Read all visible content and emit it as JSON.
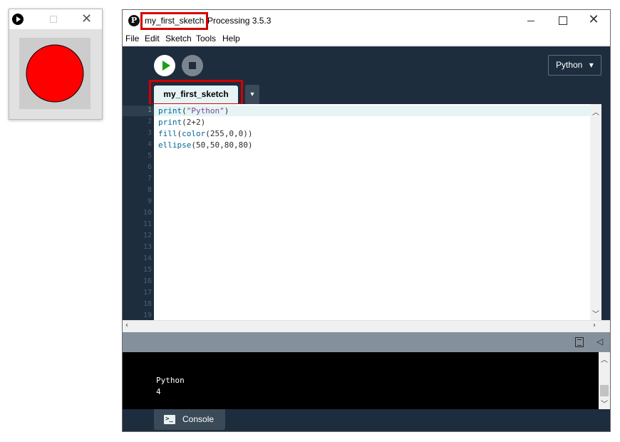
{
  "sketch_window": {
    "circle_color": "#ff0000",
    "background_color": "#cccccc"
  },
  "main_window": {
    "title_sketch": "my_first_sketch",
    "title_app": "Processing 3.5.3"
  },
  "menu": {
    "items": [
      "File",
      "Edit",
      "Sketch",
      "Tools",
      "Help"
    ]
  },
  "toolbar": {
    "run_icon": "play-icon",
    "stop_icon": "stop-icon",
    "mode": "Python",
    "mode_caret": "▾"
  },
  "tabs": {
    "active": "my_first_sketch",
    "menu_caret": "▾"
  },
  "editor": {
    "line_numbers": [
      "1",
      "2",
      "3",
      "4",
      "5",
      "6",
      "7",
      "8",
      "9",
      "10",
      "11",
      "12",
      "13",
      "14",
      "15",
      "16",
      "17",
      "18",
      "19"
    ],
    "code": [
      {
        "fn": "print",
        "args_before": "(",
        "str": "\"Python\"",
        "args_after": ")"
      },
      {
        "fn": "print",
        "args_before": "(2+2)",
        "str": "",
        "args_after": ""
      },
      {
        "fn": "fill",
        "args_before": "(",
        "fn2": "color",
        "args_mid": "(255,0,0))"
      },
      {
        "fn": "ellipse",
        "args_before": "(50,50,80,80)",
        "str": "",
        "args_after": ""
      }
    ],
    "code_text": [
      "print(\"Python\")",
      "print(2+2)",
      "fill(color(255,0,0))",
      "ellipse(50,50,80,80)"
    ]
  },
  "console": {
    "output": [
      "Python",
      "4"
    ],
    "tab_label": "Console",
    "tab_icon": ">_"
  },
  "colors": {
    "accent_highlight": "#d40000",
    "toolbar_bg": "#1d2d3e",
    "run_green": "#18a01a"
  }
}
